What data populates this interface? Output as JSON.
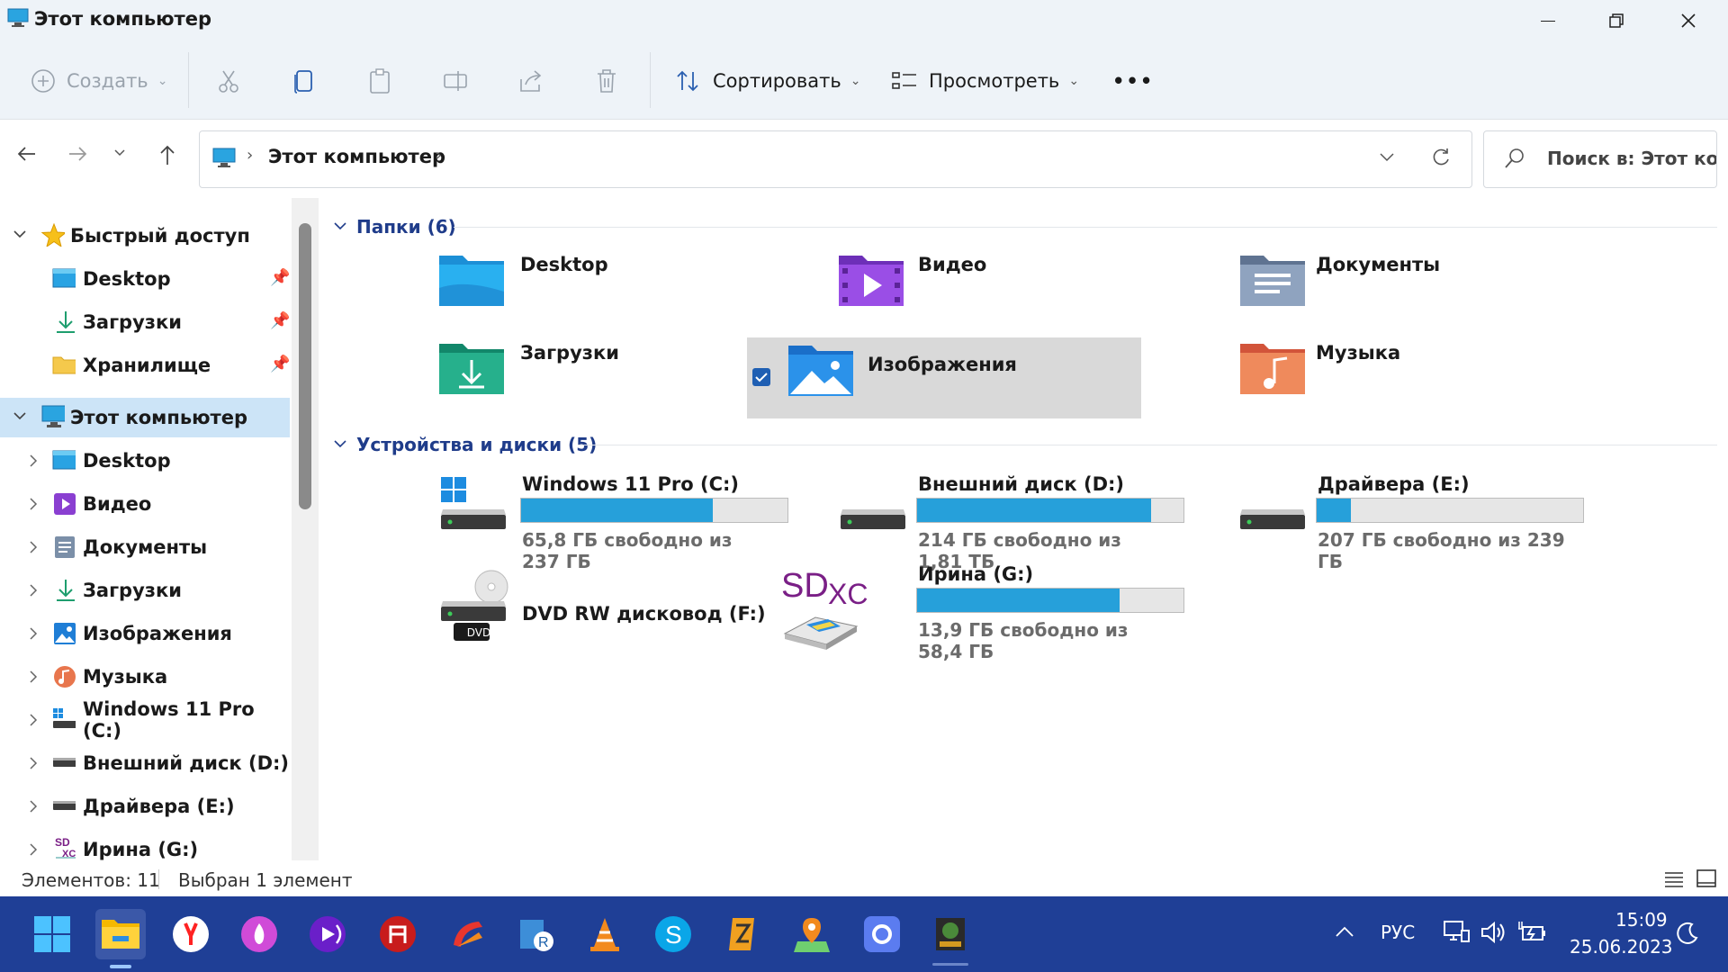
{
  "window": {
    "title": "Этот компьютер"
  },
  "toolbar": {
    "create_label": "Создать",
    "sort_label": "Сортировать",
    "view_label": "Просмотреть",
    "more_label": "•••"
  },
  "address": {
    "path_root": "Этот компьютер",
    "separator": "›"
  },
  "search": {
    "placeholder": "Поиск в: Этот ко..."
  },
  "sidebar": {
    "items": [
      {
        "label": "Быстрый доступ",
        "icon": "star-icon"
      },
      {
        "label": "Desktop",
        "icon": "desktop-folder-icon",
        "pinned": true
      },
      {
        "label": "Загрузки",
        "icon": "download-icon",
        "pinned": true
      },
      {
        "label": "Хранилище",
        "icon": "folder-icon",
        "pinned": true
      },
      {
        "label": "Этот компьютер",
        "icon": "computer-icon",
        "selected": true
      },
      {
        "label": "Desktop",
        "icon": "desktop-folder-icon"
      },
      {
        "label": "Видео",
        "icon": "video-icon"
      },
      {
        "label": "Документы",
        "icon": "documents-icon"
      },
      {
        "label": "Загрузки",
        "icon": "download-icon"
      },
      {
        "label": "Изображения",
        "icon": "pictures-icon"
      },
      {
        "label": "Музыка",
        "icon": "music-icon"
      },
      {
        "label": "Windows 11 Pro (C:)",
        "icon": "system-drive-icon"
      },
      {
        "label": "Внешний диск (D:)",
        "icon": "drive-icon"
      },
      {
        "label": "Драйвера (E:)",
        "icon": "drive-icon"
      },
      {
        "label": "Ирина (G:)",
        "icon": "sdxc-icon"
      }
    ]
  },
  "main": {
    "folders_header": "Папки (6)",
    "folders": [
      {
        "label": "Desktop"
      },
      {
        "label": "Видео"
      },
      {
        "label": "Документы"
      },
      {
        "label": "Загрузки"
      },
      {
        "label": "Изображения",
        "selected": true
      },
      {
        "label": "Музыка"
      }
    ],
    "drives_header": "Устройства и диски (5)",
    "drives": [
      {
        "name": "Windows 11 Pro (C:)",
        "free_text": "65,8 ГБ свободно из 237 ГБ",
        "used_fraction": 0.72
      },
      {
        "name": "Внешний диск (D:)",
        "free_text": "214 ГБ свободно из 1,81 ТБ",
        "used_fraction": 0.88
      },
      {
        "name": "Драйвера (E:)",
        "free_text": "207 ГБ свободно из 239 ГБ",
        "used_fraction": 0.13
      },
      {
        "name": "DVD RW дисковод (F:)",
        "free_text": "",
        "dvd_label": "DVD"
      },
      {
        "name": "Ирина (G:)",
        "free_text": "13,9 ГБ свободно из 58,4 ГБ",
        "used_fraction": 0.76,
        "sd_label_1": "SD",
        "sd_label_2": "XC"
      }
    ]
  },
  "status": {
    "count": "Элементов: 11",
    "selected": "Выбран 1 элемент"
  },
  "taskbar": {
    "lang": "РУС",
    "time": "15:09",
    "date": "25.06.2023"
  },
  "colors": {
    "accent": "#26a0da",
    "taskbar": "#1f3f96",
    "selection": "#cce4f7",
    "header": "#1f3c8a"
  }
}
